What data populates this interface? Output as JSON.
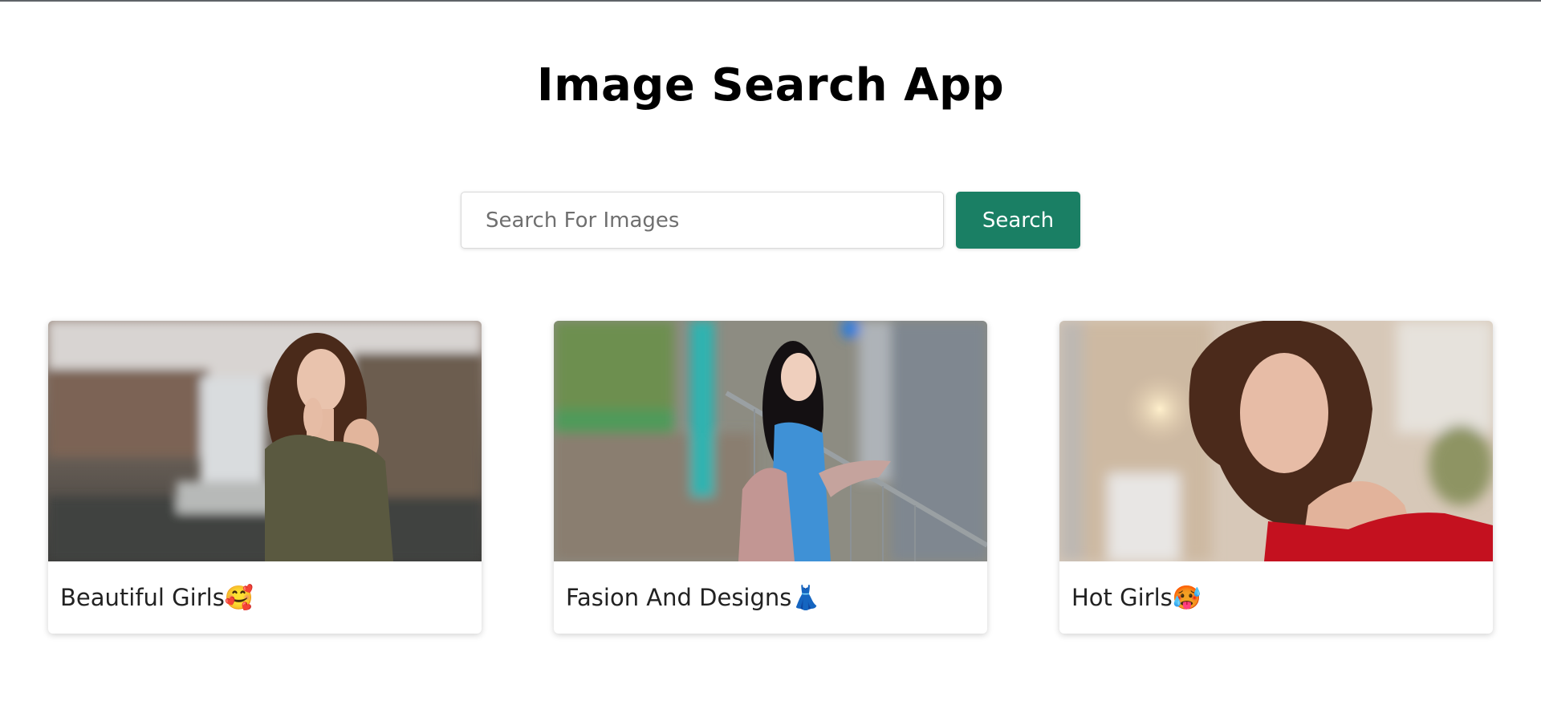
{
  "header": {
    "title": "Image Search App"
  },
  "search": {
    "placeholder": "Search For Images",
    "value": "",
    "button_label": "Search"
  },
  "colors": {
    "accent": "#1a7f64",
    "title": "#000000",
    "background": "#ffffff"
  },
  "results": [
    {
      "caption": "Beautiful Girls🥰",
      "image": "woman-portrait-snowy-waterfall"
    },
    {
      "caption": "Fasion And Designs👗",
      "image": "woman-blue-dress-bridge-railing"
    },
    {
      "caption": "Hot Girls🥵",
      "image": "woman-portrait-red-top"
    }
  ]
}
